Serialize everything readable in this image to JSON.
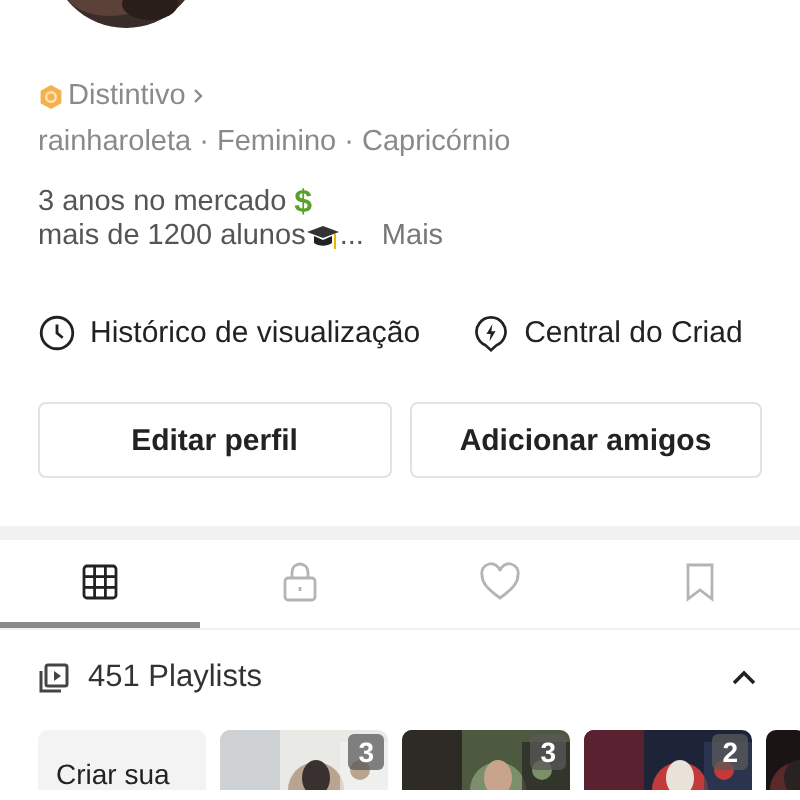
{
  "badge": {
    "label": "Distintivo"
  },
  "info": "rainharoleta · Feminino · Capricórnio",
  "bio": {
    "line1": "3 anos no mercado",
    "symbol": "$",
    "line2": "mais de 1200 alunos",
    "ellipsis": "...",
    "more": "Mais"
  },
  "links": [
    {
      "kind": "history",
      "label": "Histórico de visualização"
    },
    {
      "kind": "creator",
      "label": "Central do Criad"
    }
  ],
  "buttons": [
    "Editar perfil",
    "Adicionar amigos"
  ],
  "tabs": [
    {
      "kind": "grid",
      "selected": true
    },
    {
      "kind": "lock",
      "selected": false
    },
    {
      "kind": "heart",
      "selected": false
    },
    {
      "kind": "bookmark",
      "selected": false
    }
  ],
  "playlists": {
    "title": "451 Playlists",
    "expanded": true,
    "create_label": "Criar sua",
    "items": [
      {
        "kind": "picture",
        "count": "3"
      },
      {
        "kind": "picture",
        "count": "3"
      },
      {
        "kind": "picture",
        "count": "2"
      },
      {
        "kind": "picture"
      }
    ]
  }
}
